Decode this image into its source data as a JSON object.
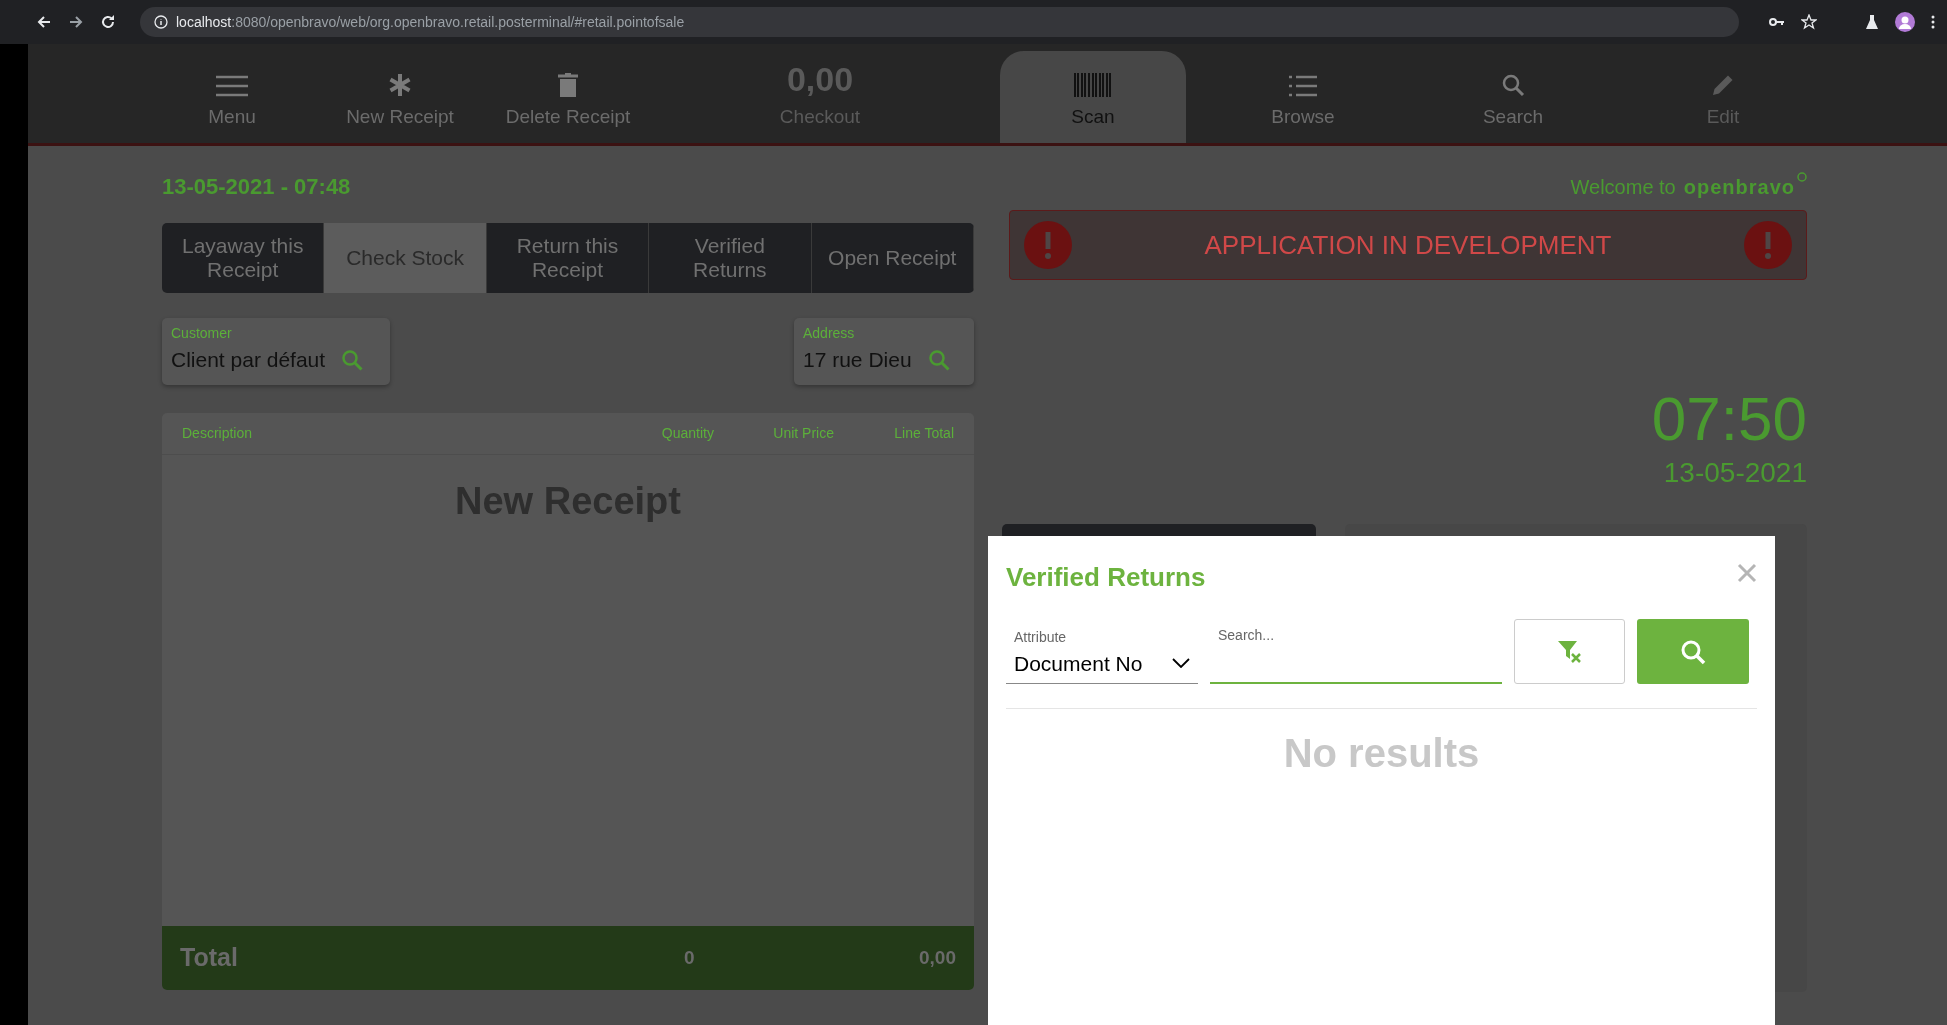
{
  "browser": {
    "url_host": "localhost",
    "url_path": ":8080/openbravo/web/org.openbravo.retail.posterminal/#retail.pointofsale"
  },
  "toolbar": [
    {
      "label": "Menu",
      "selected": false,
      "disabled": false
    },
    {
      "label": "New Receipt",
      "selected": false,
      "disabled": false
    },
    {
      "label": "Delete Receipt",
      "selected": false,
      "disabled": false
    },
    {
      "label": "Checkout",
      "amount": "0,00",
      "selected": false,
      "disabled": true
    },
    {
      "label": "Scan",
      "selected": true,
      "disabled": false
    },
    {
      "label": "Browse",
      "selected": false,
      "disabled": false
    },
    {
      "label": "Search",
      "selected": false,
      "disabled": false
    },
    {
      "label": "Edit",
      "selected": false,
      "disabled": true
    }
  ],
  "receipt_datetime": "13-05-2021 - 07:48",
  "actions": [
    {
      "label": "Layaway this Receipt",
      "disabled": false
    },
    {
      "label": "Check Stock",
      "disabled": true
    },
    {
      "label": "Return this Receipt",
      "disabled": false
    },
    {
      "label": "Verified Returns",
      "disabled": false
    },
    {
      "label": "Open Receipt",
      "disabled": false
    }
  ],
  "customer": {
    "label": "Customer",
    "value": "Client par défaut"
  },
  "address": {
    "label": "Address",
    "value": "17 rue Dieu"
  },
  "receipt": {
    "columns": [
      "Description",
      "Quantity",
      "Unit Price",
      "Line Total"
    ],
    "empty_title": "New Receipt",
    "total_label": "Total",
    "total_quantity": "0",
    "total_amount": "0,00"
  },
  "welcome": {
    "text": "Welcome to",
    "brand": "openbravo"
  },
  "banner": "APPLICATION IN DEVELOPMENT",
  "clock": {
    "time": "07:50",
    "date": "13-05-2021"
  },
  "dialog": {
    "title": "Verified Returns",
    "attribute_label": "Attribute",
    "attribute_value": "Document No",
    "search_label": "Search...",
    "empty": "No results"
  }
}
